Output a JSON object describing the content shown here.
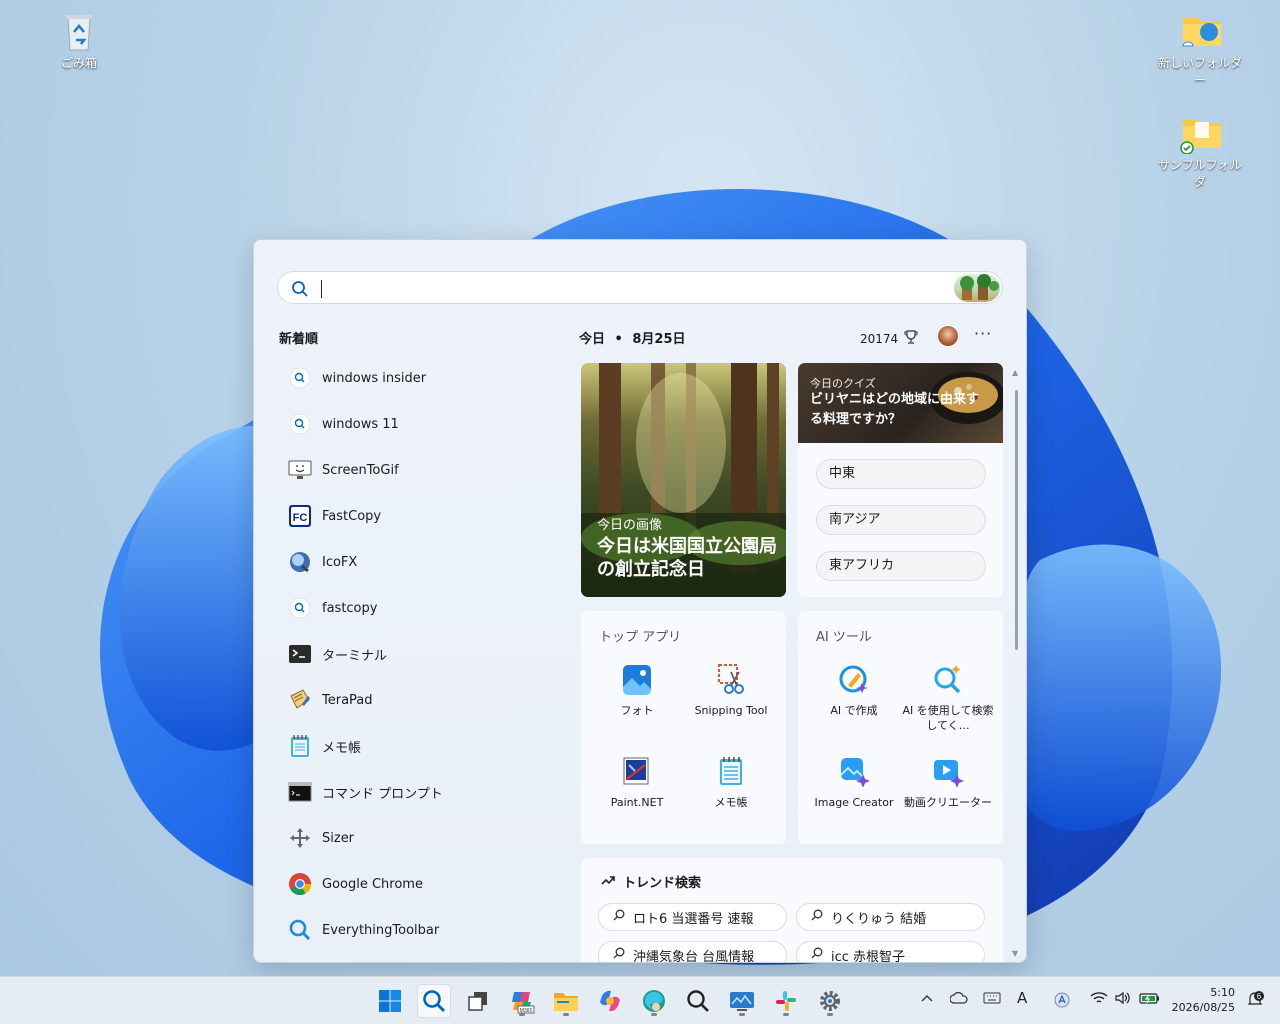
{
  "desktop": {
    "icons": [
      {
        "label": "ごみ箱",
        "icon": "recycle-bin-icon"
      },
      {
        "label": "新しいフォルダー",
        "icon": "folder-cloud-icon"
      },
      {
        "label": "サンプルフォルダ",
        "icon": "folder-synced-icon"
      }
    ]
  },
  "search": {
    "value": "",
    "placeholder": ""
  },
  "recent": {
    "title": "新着順",
    "items": [
      {
        "label": "windows insider",
        "icon": "search-icon"
      },
      {
        "label": "windows 11",
        "icon": "search-icon"
      },
      {
        "label": "ScreenToGif",
        "icon": "screentogif-icon"
      },
      {
        "label": "FastCopy",
        "icon": "fastcopy-icon"
      },
      {
        "label": "IcoFX",
        "icon": "icofx-icon"
      },
      {
        "label": "fastcopy",
        "icon": "search-icon"
      },
      {
        "label": "ターミナル",
        "icon": "terminal-icon"
      },
      {
        "label": "TeraPad",
        "icon": "terapad-icon"
      },
      {
        "label": "メモ帳",
        "icon": "notepad-icon"
      },
      {
        "label": "コマンド プロンプト",
        "icon": "cmd-icon"
      },
      {
        "label": "Sizer",
        "icon": "sizer-icon"
      },
      {
        "label": "Google Chrome",
        "icon": "chrome-icon"
      },
      {
        "label": "EverythingToolbar",
        "icon": "everything-toolbar-icon"
      }
    ]
  },
  "header": {
    "today": "今日",
    "date": "8月25日",
    "points": "20174"
  },
  "image_card": {
    "kicker": "今日の画像",
    "headline": "今日は米国国立公園局の創立記念日"
  },
  "quiz": {
    "kicker": "今日のクイズ",
    "question": "ビリヤニはどの地域に由来する料理ですか？",
    "options": [
      "中東",
      "南アジア",
      "東アフリカ"
    ]
  },
  "top_apps": {
    "title": "トップ アプリ",
    "apps": [
      {
        "label": "フォト",
        "icon": "photos-icon"
      },
      {
        "label": "Snipping Tool",
        "icon": "snipping-tool-icon"
      },
      {
        "label": "Paint.NET",
        "icon": "paintnet-icon"
      },
      {
        "label": "メモ帳",
        "icon": "notepad-icon"
      }
    ]
  },
  "ai_tools": {
    "title": "AI ツール",
    "apps": [
      {
        "label": "AI で作成",
        "icon": "ai-create-icon"
      },
      {
        "label": "AI を使用して検索してく…",
        "icon": "ai-search-icon"
      },
      {
        "label": "Image Creator",
        "icon": "image-creator-icon"
      },
      {
        "label": "動画クリエーター",
        "icon": "video-creator-icon"
      }
    ]
  },
  "trending": {
    "title": "トレンド検索",
    "items": [
      "ロト6 当選番号 速報",
      "りくりゅう 結婚",
      "沖縄気象台 台風情報",
      "icc 赤根智子"
    ]
  },
  "taskbar": {
    "time": "5:10",
    "date": "2026/08/25",
    "ime": "A",
    "notification_count": "6"
  },
  "colors": {
    "accent": "#0067c0",
    "panel_bg": "#eef3fa"
  }
}
